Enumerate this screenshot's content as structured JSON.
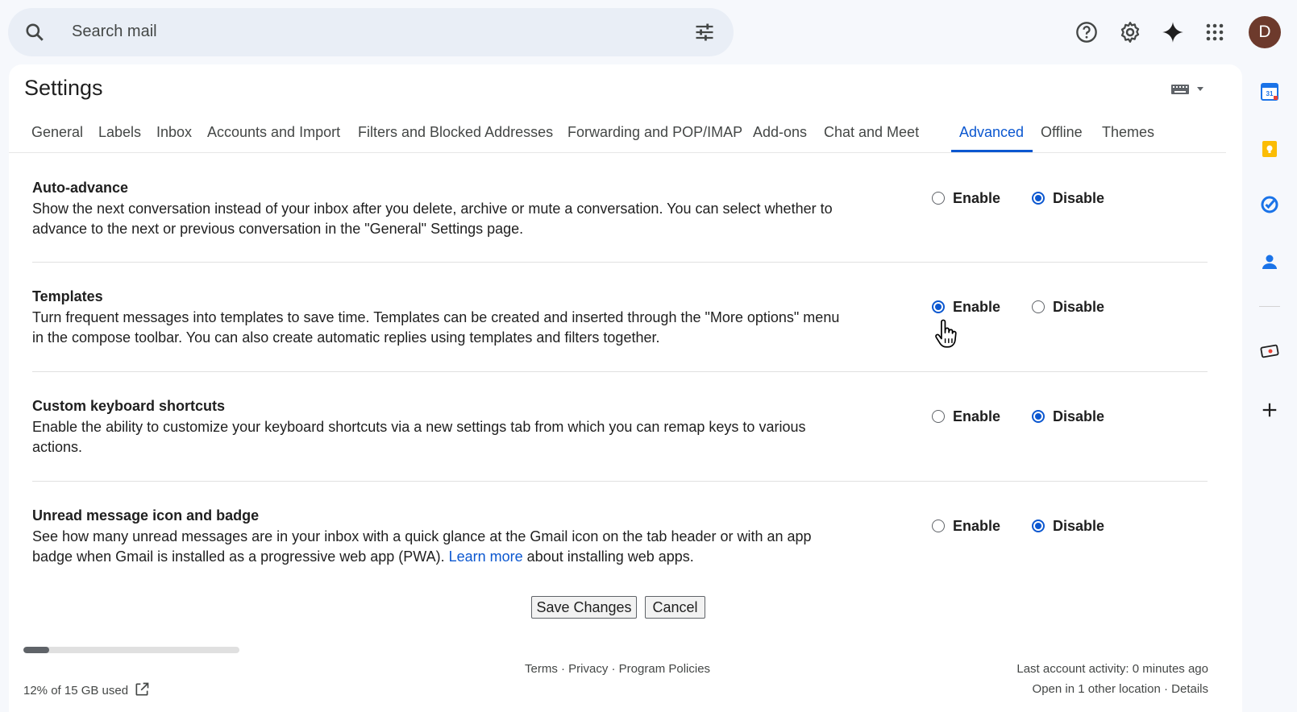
{
  "search": {
    "placeholder": "Search mail"
  },
  "header": {
    "avatar_letter": "D"
  },
  "settings": {
    "title": "Settings",
    "tabs": [
      "General",
      "Labels",
      "Inbox",
      "Accounts and Import",
      "Filters and Blocked Addresses",
      "Forwarding and POP/IMAP",
      "Add-ons",
      "Chat and Meet",
      "Advanced",
      "Offline",
      "Themes"
    ],
    "active_tab": "Advanced",
    "items": [
      {
        "title": "Auto-advance",
        "desc": "Show the next conversation instead of your inbox after you delete, archive or mute a conversation. You can select whether to advance to the next or previous conversation in the \"General\" Settings page.",
        "enable_label": "Enable",
        "disable_label": "Disable",
        "selected": "Disable"
      },
      {
        "title": "Templates",
        "desc": "Turn frequent messages into templates to save time. Templates can be created and inserted through the \"More options\" menu in the compose toolbar. You can also create automatic replies using templates and filters together.",
        "enable_label": "Enable",
        "disable_label": "Disable",
        "selected": "Enable"
      },
      {
        "title": "Custom keyboard shortcuts",
        "desc": "Enable the ability to customize your keyboard shortcuts via a new settings tab from which you can remap keys to various actions.",
        "enable_label": "Enable",
        "disable_label": "Disable",
        "selected": "Disable"
      },
      {
        "title": "Unread message icon and badge",
        "desc_before": "See how many unread messages are in your inbox with a quick glance at the Gmail icon on the tab header or with an app badge when Gmail is installed as a progressive web app (PWA).",
        "desc_link": "Learn more",
        "desc_after": "about installing web apps.",
        "enable_label": "Enable",
        "disable_label": "Disable",
        "selected": "Disable"
      }
    ],
    "save_label": "Save Changes",
    "cancel_label": "Cancel"
  },
  "footer": {
    "storage_text": "12% of 15 GB used",
    "storage_fraction": 0.12,
    "links": "Terms · Privacy · Program Policies",
    "activity": "Last account activity: 0 minutes ago",
    "location": "Open in 1 other location · Details"
  },
  "colors": {
    "accent": "#0b57d0",
    "background": "#f6f8fc",
    "avatar": "#6d3a2c"
  },
  "icons": [
    "search-icon",
    "tune-icon",
    "help-icon",
    "gear-icon",
    "gemini-icon",
    "apps-icon",
    "keyboard-icon",
    "calendar-icon",
    "keep-icon",
    "tasks-icon",
    "contacts-icon",
    "ticket-icon",
    "add-icon",
    "open-external-icon",
    "hand-cursor-icon"
  ]
}
